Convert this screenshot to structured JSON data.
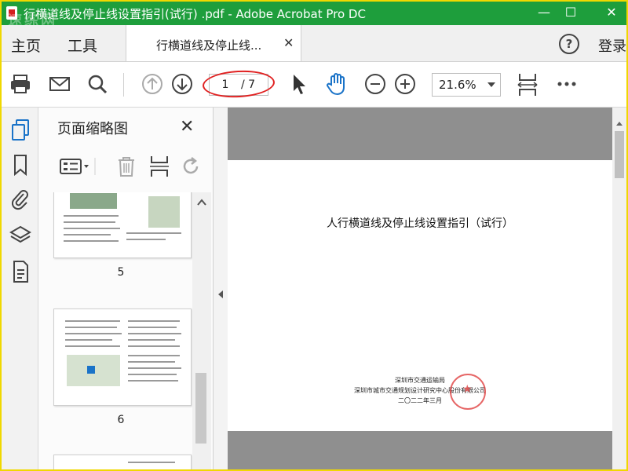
{
  "window": {
    "title": "行横道线及停止线设置指引(试行)  .pdf - Adobe Acrobat Pro DC",
    "watermark": "速练网",
    "minimize": "—",
    "maximize": "☐",
    "close": "✕"
  },
  "tabs": {
    "home": "主页",
    "tools": "工具",
    "doc_tab": "行横道线及停止线...",
    "doc_close": "✕",
    "help": "?",
    "login": "登录"
  },
  "toolbar": {
    "current_page": "1",
    "total_pages": "/ 7",
    "zoom": "21.6%"
  },
  "thumbnail_panel": {
    "title": "页面缩略图",
    "close": "✕",
    "pages": [
      {
        "label": "5"
      },
      {
        "label": "6"
      }
    ]
  },
  "document": {
    "title": "人行横道线及停止线设置指引（试行）",
    "issuer_lines": [
      "深圳市交通运输局",
      "深圳市城市交通规划设计研究中心股份有限公司",
      "二〇二二年三月"
    ]
  },
  "colors": {
    "titlebar": "#1e9e3c",
    "accent_blue": "#1a73c8",
    "annotation_red": "#e02020",
    "frame": "#f0d800"
  },
  "icons": {
    "toolbar": [
      "print-icon",
      "email-icon",
      "search-icon",
      "page-up-icon",
      "page-down-icon",
      "select-cursor-icon",
      "hand-tool-icon",
      "zoom-out-icon",
      "zoom-in-icon",
      "fit-page-icon",
      "more-icon"
    ],
    "rail": [
      "pages-icon",
      "bookmark-icon",
      "attachment-icon",
      "layers-icon",
      "document-properties-icon"
    ]
  }
}
